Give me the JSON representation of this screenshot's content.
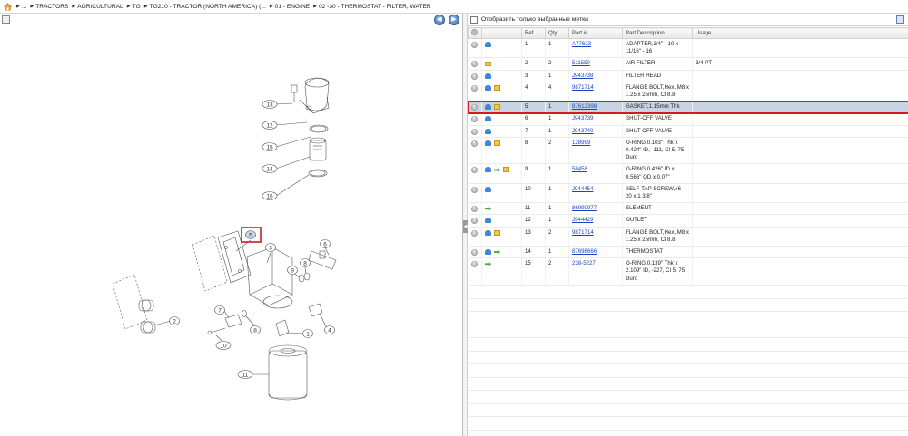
{
  "breadcrumb": {
    "home_icon": "home-icon",
    "items": [
      {
        "label": "..."
      },
      {
        "label": "TRACTORS"
      },
      {
        "label": "AGRICULTURAL"
      },
      {
        "label": "TG"
      },
      {
        "label": "TG210 - TRACTOR (NORTH AMERICA) (..."
      },
      {
        "label": "01 - ENGINE"
      },
      {
        "label": "02 -30 - THERMOSTAT - FILTER, WATER"
      }
    ]
  },
  "left_pane": {
    "prev_label": "◀",
    "next_label": "▶",
    "callouts": [
      "13",
      "12",
      "15",
      "14",
      "15",
      "5",
      "3",
      "6",
      "9",
      "8",
      "2",
      "7",
      "8",
      "1",
      "4",
      "10",
      "11"
    ],
    "highlight_callout": "5"
  },
  "right_pane": {
    "filter_label": "Отобразить только выбранные метки",
    "columns": [
      "",
      "",
      "Ref",
      "Qty",
      "Part #",
      "Part Description",
      "Usage"
    ],
    "rows": [
      {
        "ref": "1",
        "qty": "1",
        "part": "A77623",
        "desc": "ADAPTER,3/4\" - 10 x 11/16\" - 16",
        "usage": "",
        "icons": [
          "plus-icon",
          "pointer-icon"
        ]
      },
      {
        "ref": "2",
        "qty": "2",
        "part": "511550",
        "desc": "AIR FILTER",
        "usage": "3/4 PT",
        "icons": [
          "plus-icon",
          "folder-icon"
        ]
      },
      {
        "ref": "3",
        "qty": "1",
        "part": "J943738",
        "desc": "FILTER HEAD",
        "usage": "",
        "icons": [
          "plus-icon",
          "pointer-icon"
        ]
      },
      {
        "ref": "4",
        "qty": "4",
        "part": "9871714",
        "desc": "FLANGE BOLT,Hex, M8 x 1.25 x 25mm, Cl 8.8",
        "usage": "",
        "icons": [
          "plus-icon",
          "pointer-icon",
          "box-icon"
        ]
      },
      {
        "ref": "5",
        "qty": "1",
        "part": "87612398",
        "desc": "GASKET,1.15mm Thk",
        "usage": "",
        "icons": [
          "plus-icon",
          "pointer-icon",
          "box-icon"
        ],
        "selected": true
      },
      {
        "ref": "6",
        "qty": "1",
        "part": "J943739",
        "desc": "SHUT-OFF VALVE",
        "usage": "",
        "icons": [
          "plus-icon",
          "pointer-icon"
        ]
      },
      {
        "ref": "7",
        "qty": "1",
        "part": "J943740",
        "desc": "SHUT-OFF VALVE",
        "usage": "",
        "icons": [
          "plus-icon",
          "pointer-icon"
        ]
      },
      {
        "ref": "8",
        "qty": "2",
        "part": "128999",
        "desc": "O-RING,0.103\" Thk x 0.424\" ID, -111, Cl 5, 75 Duro",
        "usage": "",
        "icons": [
          "plus-icon",
          "pointer-icon",
          "box-icon"
        ]
      },
      {
        "ref": "9",
        "qty": "1",
        "part": "58458",
        "desc": "O-RING,0.426\" ID x 0.566\" OD x 0.07\"",
        "usage": "",
        "icons": [
          "plus-icon",
          "pointer-icon",
          "arrow-icon",
          "box-icon"
        ]
      },
      {
        "ref": "10",
        "qty": "1",
        "part": "J944454",
        "desc": "SELF-TAP SCREW,#6 - 20 x 1 3/8\"",
        "usage": "",
        "icons": [
          "plus-icon",
          "pointer-icon"
        ]
      },
      {
        "ref": "11",
        "qty": "1",
        "part": "86990977",
        "desc": "ELEMENT",
        "usage": "",
        "icons": [
          "plus-icon",
          "arrow-icon"
        ]
      },
      {
        "ref": "12",
        "qty": "1",
        "part": "J944429",
        "desc": "OUTLET",
        "usage": "",
        "icons": [
          "plus-icon",
          "pointer-icon"
        ]
      },
      {
        "ref": "13",
        "qty": "2",
        "part": "9871714",
        "desc": "FLANGE BOLT,Hex, M8 x 1.25 x 25mm, Cl 8.8",
        "usage": "",
        "icons": [
          "plus-icon",
          "pointer-icon",
          "box-icon"
        ]
      },
      {
        "ref": "14",
        "qty": "1",
        "part": "87698666",
        "desc": "THERMOSTAT",
        "usage": "",
        "icons": [
          "plus-icon",
          "pointer-icon",
          "arrow-icon"
        ]
      },
      {
        "ref": "15",
        "qty": "2",
        "part": "238-5227",
        "desc": "O-RING,0.139\" Thk x 2.109\" ID, -227, Cl 5, 75 Duro",
        "usage": "",
        "icons": [
          "plus-icon",
          "arrow-icon"
        ]
      }
    ]
  },
  "colors": {
    "selected_row_bg": "#c8d3e3",
    "highlight_red": "#d11c1c",
    "link_blue": "#1a44c4"
  }
}
